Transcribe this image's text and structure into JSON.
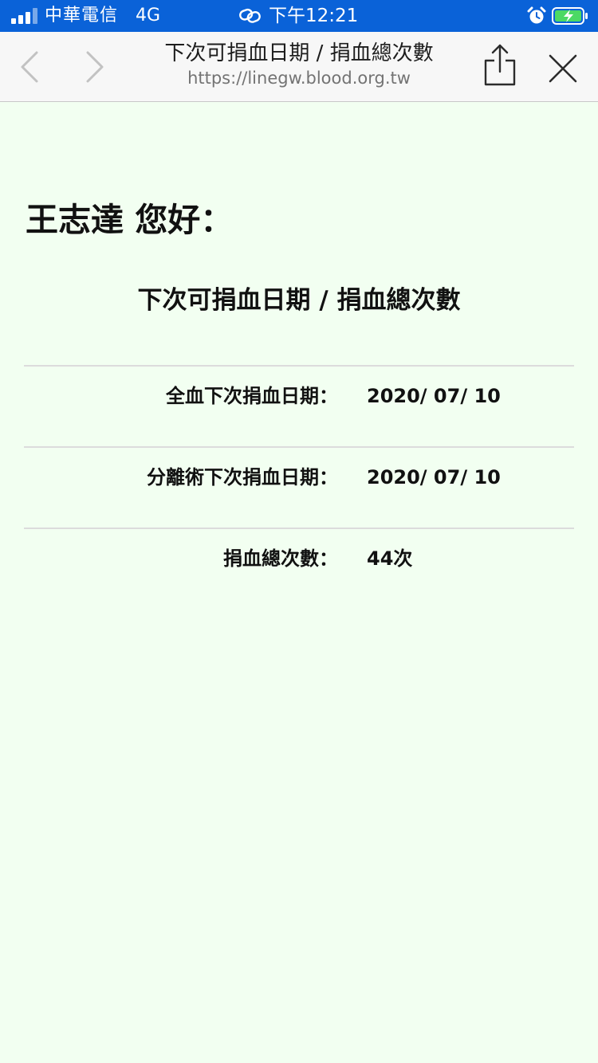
{
  "status_bar": {
    "carrier": "中華電信",
    "network": "4G",
    "time": "下午12:21",
    "bar_color": "#0a62d8",
    "battery_color": "#4cd964"
  },
  "nav": {
    "title": "下次可捐血日期 / 捐血總次數",
    "url": "https://linegw.blood.org.tw"
  },
  "page": {
    "greeting": "王志達 您好：",
    "heading": "下次可捐血日期 / 捐血總次數",
    "background": "#f2fff1",
    "rows": [
      {
        "label": "全血下次捐血日期：",
        "value": "2020/ 07/ 10"
      },
      {
        "label": "分離術下次捐血日期：",
        "value": "2020/ 07/ 10"
      },
      {
        "label": "捐血總次數：",
        "value": "44次"
      }
    ]
  }
}
